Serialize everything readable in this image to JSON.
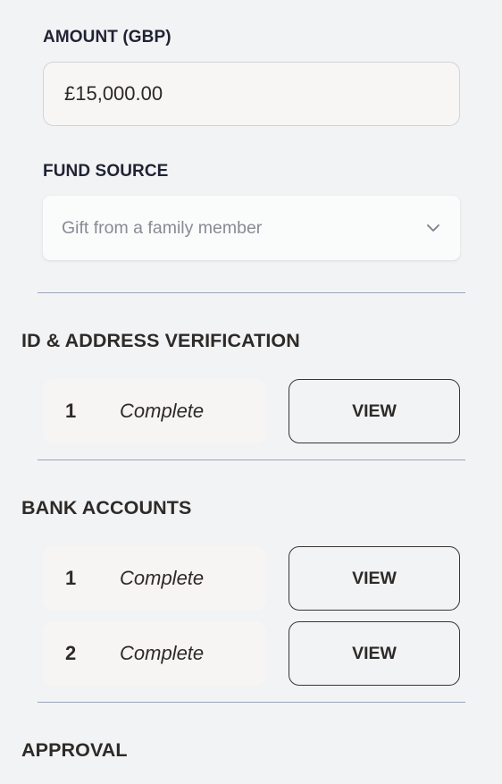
{
  "amount": {
    "label": "AMOUNT (GBP)",
    "value": "£15,000.00"
  },
  "fund_source": {
    "label": "FUND SOURCE",
    "selected": "Gift from a family member",
    "icon": "chevron-down-icon"
  },
  "sections": {
    "id_verification": {
      "title": "ID & ADDRESS VERIFICATION",
      "rows": [
        {
          "index": "1",
          "status": "Complete",
          "action": "VIEW"
        }
      ]
    },
    "bank_accounts": {
      "title": "BANK ACCOUNTS",
      "rows": [
        {
          "index": "1",
          "status": "Complete",
          "action": "VIEW"
        },
        {
          "index": "2",
          "status": "Complete",
          "action": "VIEW"
        }
      ]
    },
    "approval": {
      "title": "APPROVAL"
    }
  },
  "colors": {
    "background": "#f2f3f5",
    "divider": "#9ba4bb",
    "text_dark": "#2d2a28",
    "label_dark": "#1f2333",
    "placeholder_gray": "#878b94",
    "card_bg": "#f7f5f4"
  }
}
